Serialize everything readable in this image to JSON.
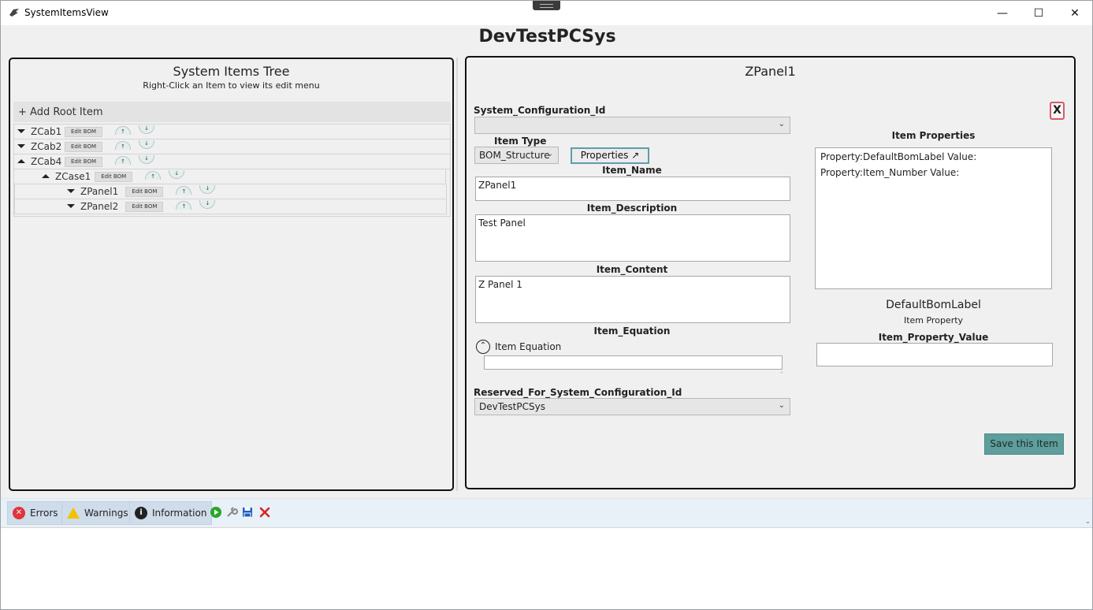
{
  "window": {
    "title": "SystemItemsView",
    "minimize": "—",
    "maximize": "☐",
    "close": "✕"
  },
  "page_title": "DevTestPCSys",
  "tree_panel": {
    "title": "System Items Tree",
    "subtitle": "Right-Click an Item to view its edit menu",
    "add_root_label": "+ Add Root Item",
    "edit_label": "Edit BOM",
    "up_glyph": "↑",
    "down_glyph": "↓",
    "items": [
      {
        "label": "ZCab1",
        "expanded": false,
        "depth": 0
      },
      {
        "label": "ZCab2",
        "expanded": false,
        "depth": 0
      },
      {
        "label": "ZCab4",
        "expanded": true,
        "depth": 0
      },
      {
        "label": "ZCase1",
        "expanded": true,
        "depth": 1
      },
      {
        "label": "ZPanel1",
        "expanded": false,
        "depth": 2
      },
      {
        "label": "ZPanel2",
        "expanded": false,
        "depth": 2
      }
    ]
  },
  "detail": {
    "heading": "ZPanel1",
    "close_label": "X",
    "system_configuration_id": {
      "label": "System_Configuration_Id",
      "value": ""
    },
    "item_type": {
      "label": "Item Type",
      "value": "BOM_Structure"
    },
    "properties_button": "Properties ↗",
    "item_name": {
      "label": "Item_Name",
      "value": "ZPanel1"
    },
    "item_description": {
      "label": "Item_Description",
      "value": "Test Panel"
    },
    "item_content": {
      "label": "Item_Content",
      "value": "Z Panel 1"
    },
    "item_equation": {
      "label": "Item_Equation",
      "expander_label": "Item Equation",
      "value": ""
    },
    "reserved_for": {
      "label": "Reserved_For_System_Configuration_Id",
      "value": "DevTestPCSys"
    },
    "item_properties": {
      "label": "Item Properties",
      "entries": [
        "Property:DefaultBomLabel Value:",
        "Property:Item_Number Value:"
      ]
    },
    "selected_property_name": "DefaultBomLabel",
    "selected_property_caption": "Item Property",
    "item_property_value": {
      "label": "Item_Property_Value",
      "value": ""
    },
    "save_label": "Save this Item"
  },
  "bottom_bar": {
    "errors_label": "Errors",
    "warnings_label": "Warnings",
    "information_label": "Information"
  },
  "colors": {
    "accent": "#5e9e9c",
    "error": "#e0333b",
    "warning": "#f2c200",
    "run": "#2aa52a",
    "save": "#1f5fbf",
    "delete": "#d32626"
  }
}
